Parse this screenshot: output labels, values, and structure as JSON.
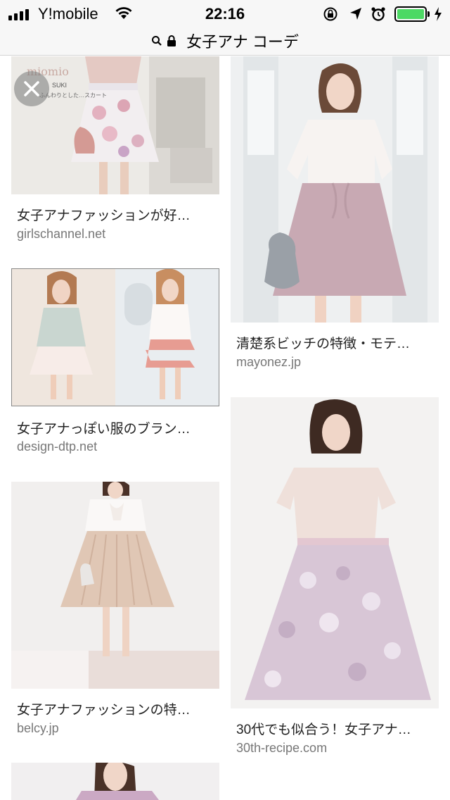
{
  "status_bar": {
    "carrier": "Y!mobile",
    "time": "22:16",
    "battery_level": 0.85,
    "icons": [
      "signal-icon",
      "wifi-icon",
      "orientation-lock-icon",
      "location-arrow-icon",
      "alarm-icon",
      "battery-icon",
      "charging-icon"
    ]
  },
  "url_bar": {
    "title": "女子アナ コーデ",
    "icons": [
      "search-icon",
      "lock-icon"
    ]
  },
  "results": [
    {
      "caption": "女子アナファッションが好…",
      "domain": "girlschannel.net",
      "thumb_text": [
        "miomio",
        "SUKI",
        "ふんわりとした…スカート"
      ]
    },
    {
      "caption": "清楚系ビッチの特徴・モテ…",
      "domain": "mayonez.jp"
    },
    {
      "caption": "女子アナっぽい服のブラン…",
      "domain": "design-dtp.net"
    },
    {
      "caption": "30代でも似合う！女子アナ…",
      "domain": "30th-recipe.com"
    },
    {
      "caption": "女子アナファッションの特…",
      "domain": "belcy.jp"
    },
    {
      "caption": "",
      "domain": ""
    }
  ],
  "colors": {
    "battery": "#4cd964",
    "caption": "#222222",
    "domain": "#777777",
    "chrome": "#f7f7f7"
  }
}
